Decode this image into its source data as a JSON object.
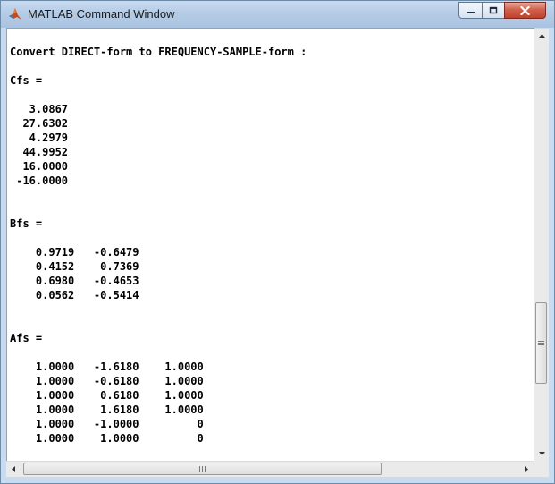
{
  "window": {
    "title": "MATLAB Command Window"
  },
  "console": {
    "output": "Convert DIRECT-form to FREQUENCY-SAMPLE-form :\n\nCfs =\n\n   3.0867\n  27.6302\n   4.2979\n  44.9952\n  16.0000\n -16.0000\n\n\nBfs =\n\n    0.9719   -0.6479\n    0.4152    0.7369\n    0.6980   -0.4653\n    0.0562   -0.5414\n\n\nAfs =\n\n    1.0000   -1.6180    1.0000\n    1.0000   -0.6180    1.0000\n    1.0000    0.6180    1.0000\n    1.0000    1.6180    1.0000\n    1.0000   -1.0000         0\n    1.0000    1.0000         0"
  },
  "icons": {
    "app": "matlab-logo-icon",
    "minimize": "minimize-icon",
    "maximize": "maximize-icon",
    "close": "close-icon"
  },
  "colors": {
    "close_button": "#c4402a",
    "titlebar": "#b5cce6"
  }
}
